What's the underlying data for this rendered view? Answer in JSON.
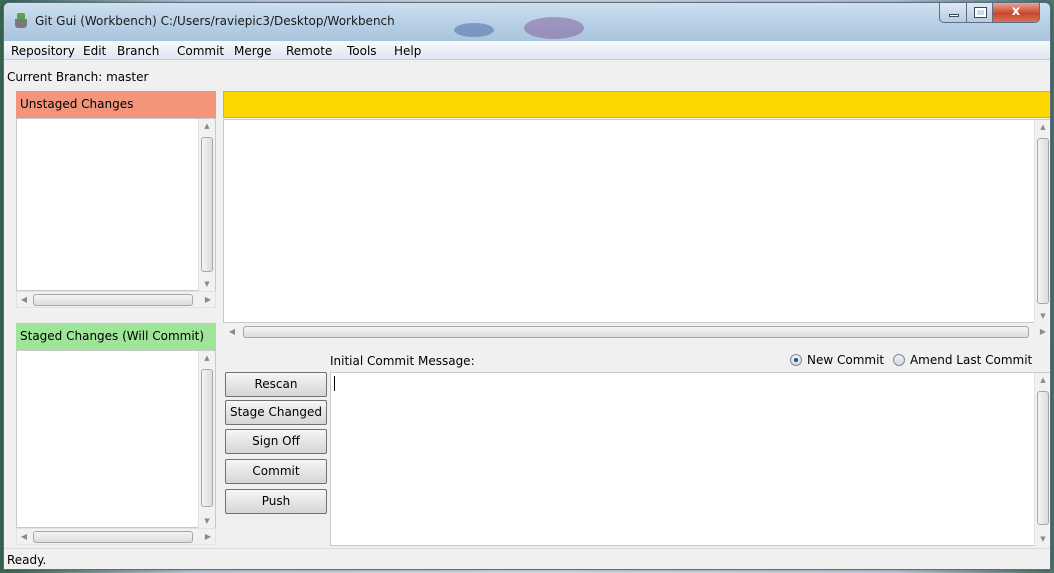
{
  "window": {
    "title": "Git Gui (Workbench) C:/Users/raviepic3/Desktop/Workbench",
    "minimize_glyph": "",
    "maximize_glyph": "",
    "close_glyph": "x"
  },
  "menubar": {
    "items": [
      "Repository",
      "Edit",
      "Branch",
      "Commit",
      "Merge",
      "Remote",
      "Tools",
      "Help"
    ]
  },
  "branch": {
    "text": "Current Branch: master"
  },
  "unstaged": {
    "header": "Unstaged Changes",
    "color": "#f2957b",
    "files": []
  },
  "staged": {
    "header": "Staged Changes (Will Commit)",
    "color": "#9ee59a",
    "files": []
  },
  "diff": {
    "header_color": "#ffd700",
    "content": ""
  },
  "commit": {
    "label": "Initial Commit Message:",
    "options": [
      "New Commit",
      "Amend Last Commit"
    ],
    "selected": "New Commit",
    "message": ""
  },
  "actions": [
    "Rescan",
    "Stage Changed",
    "Sign Off",
    "Commit",
    "Push"
  ],
  "status": {
    "text": "Ready."
  },
  "icons": [
    "git-gui-app-icon",
    "scroll-arrow-up-icon",
    "scroll-arrow-down-icon",
    "scroll-arrow-left-icon",
    "scroll-arrow-right-icon"
  ]
}
